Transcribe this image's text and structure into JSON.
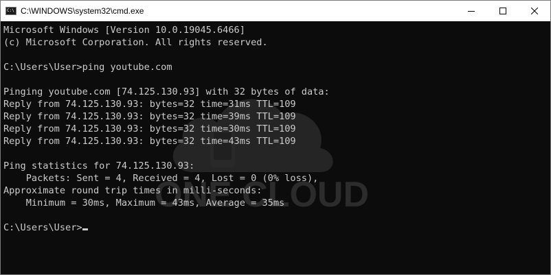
{
  "window": {
    "title": "C:\\WINDOWS\\system32\\cmd.exe",
    "icon": "cmd-icon"
  },
  "controls": {
    "minimize_icon": "minimize-icon",
    "maximize_icon": "maximize-icon",
    "close_icon": "close-icon"
  },
  "console": {
    "lines": [
      "Microsoft Windows [Version 10.0.19045.6466]",
      "(c) Microsoft Corporation. All rights reserved.",
      "",
      "C:\\Users\\User>ping youtube.com",
      "",
      "Pinging youtube.com [74.125.130.93] with 32 bytes of data:",
      "Reply from 74.125.130.93: bytes=32 time=31ms TTL=109",
      "Reply from 74.125.130.93: bytes=32 time=39ms TTL=109",
      "Reply from 74.125.130.93: bytes=32 time=30ms TTL=109",
      "Reply from 74.125.130.93: bytes=32 time=43ms TTL=109",
      "",
      "Ping statistics for 74.125.130.93:",
      "    Packets: Sent = 4, Received = 4, Lost = 0 (0% loss),",
      "Approximate round trip times in milli-seconds:",
      "    Minimum = 30ms, Maximum = 43ms, Average = 35ms",
      "",
      "C:\\Users\\User>"
    ],
    "background_color": "#0c0c0c",
    "text_color": "#cccccc"
  },
  "watermark": {
    "text": "ONE CLOUD",
    "icon": "cloud-phone-icon"
  }
}
